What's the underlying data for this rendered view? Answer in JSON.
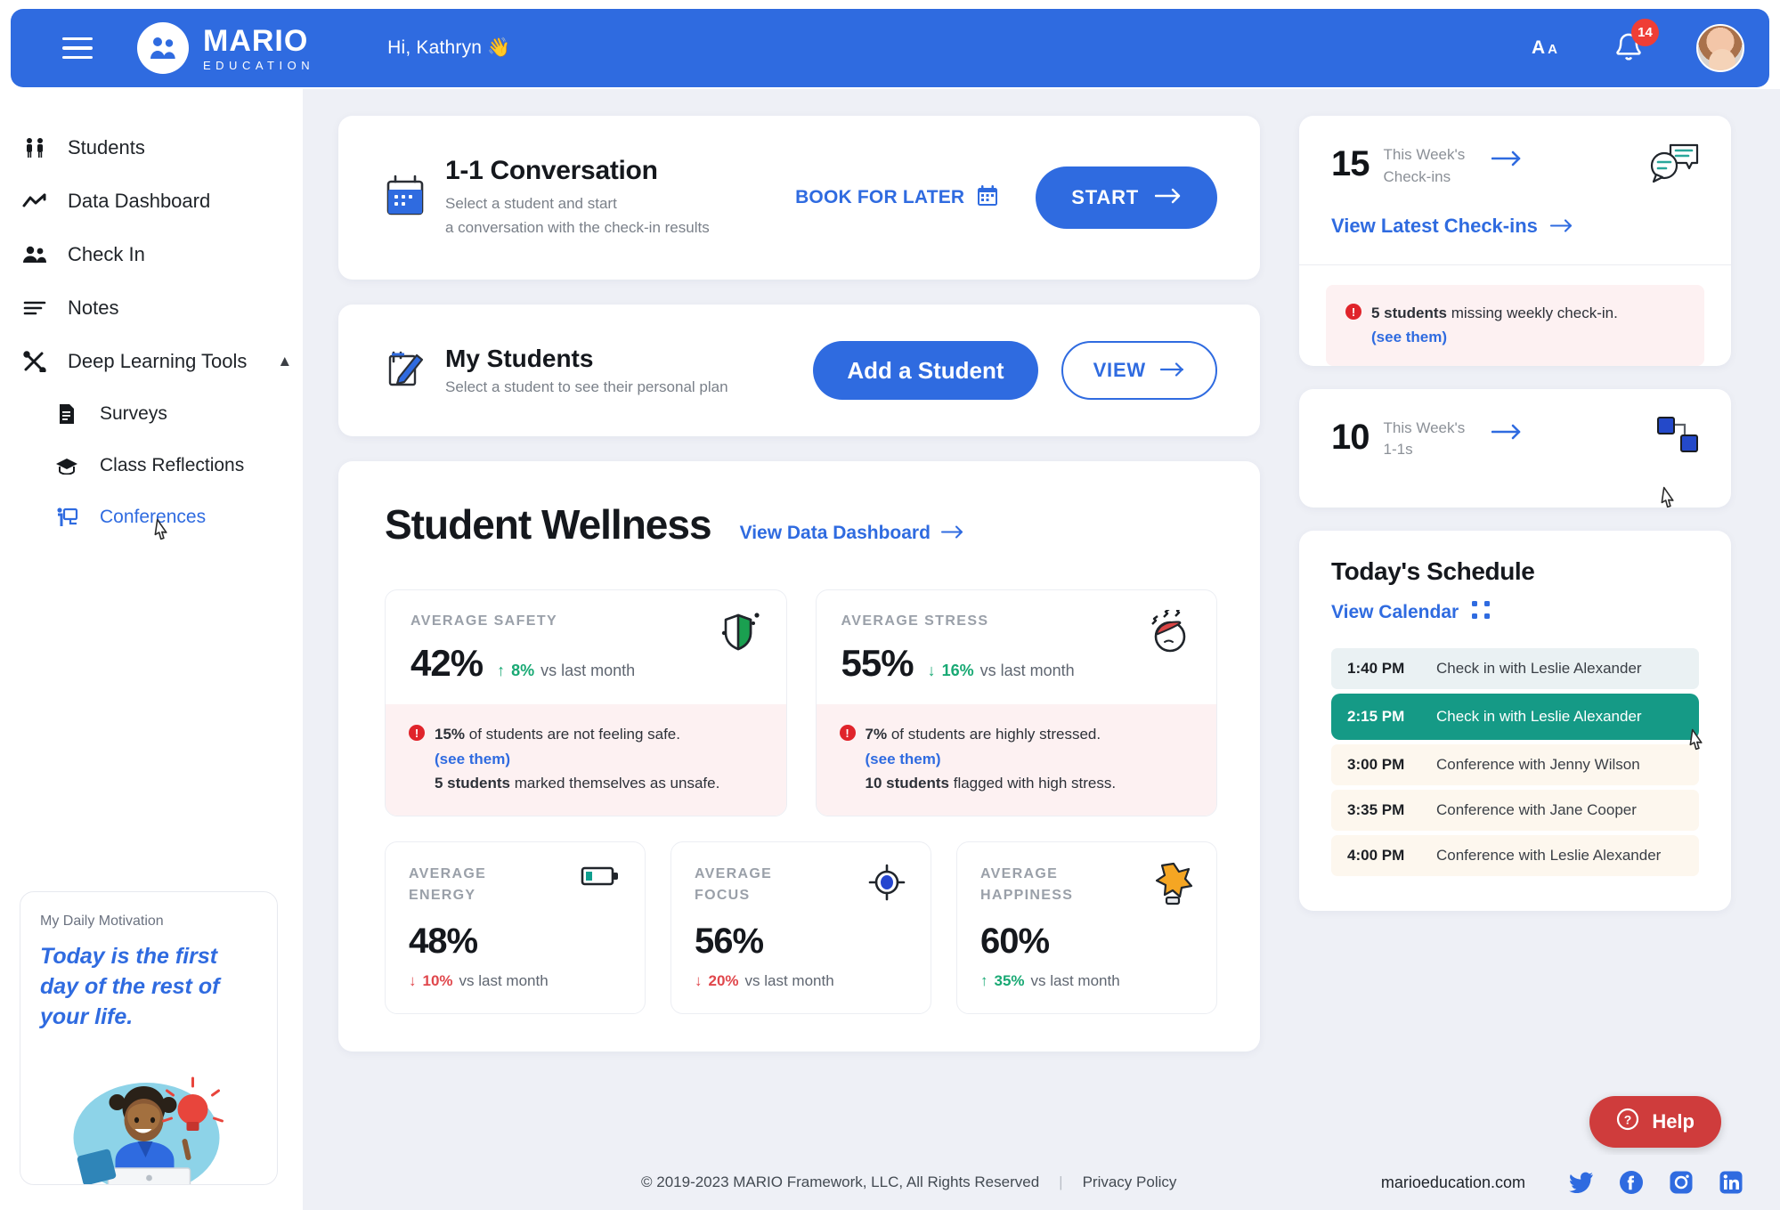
{
  "header": {
    "logo_main": "MARIO",
    "logo_sub": "EDUCATION",
    "greeting": "Hi, Kathryn 👋",
    "font_size_big": "A",
    "font_size_small": "A",
    "notification_count": "14"
  },
  "sidebar": {
    "items": [
      {
        "label": "Students",
        "icon": "students-icon"
      },
      {
        "label": "Data Dashboard",
        "icon": "chart-line-icon"
      },
      {
        "label": "Check In",
        "icon": "people-icon"
      },
      {
        "label": "Notes",
        "icon": "lines-icon"
      },
      {
        "label": "Deep Learning Tools",
        "icon": "tools-icon",
        "expanded": true
      }
    ],
    "sub_items": [
      {
        "label": "Surveys",
        "icon": "document-icon",
        "active": false
      },
      {
        "label": "Class Reflections",
        "icon": "graduation-cap-icon",
        "active": false
      },
      {
        "label": "Conferences",
        "icon": "presentation-icon",
        "active": true
      }
    ],
    "motivation": {
      "label": "My Daily Motivation",
      "quote": "Today is the first day of the rest of your life."
    }
  },
  "conversation_card": {
    "title": "1-1 Conversation",
    "subtitle_line1": "Select a student and start",
    "subtitle_line2": "a conversation with the check-in results",
    "book_label": "BOOK FOR LATER",
    "start_label": "START"
  },
  "students_card": {
    "title": "My Students",
    "subtitle": "Select a student to see their personal plan",
    "add_label": "Add a Student",
    "view_label": "VIEW"
  },
  "wellness": {
    "title": "Student Wellness",
    "link": "View Data Dashboard",
    "big_metrics": [
      {
        "label": "AVERAGE SAFETY",
        "value": "42%",
        "delta_dir": "up",
        "delta_color": "green",
        "delta_value": "8%",
        "delta_suffix": "vs last month",
        "icon": "shield-icon",
        "alert_pct": "15%",
        "alert_text": "of students are not feeling safe.",
        "alert_link": "(see them)",
        "alert_count": "5 students",
        "alert_count_text": "marked themselves as unsafe."
      },
      {
        "label": "AVERAGE STRESS",
        "value": "55%",
        "delta_dir": "down",
        "delta_color": "green",
        "delta_value": "16%",
        "delta_suffix": "vs last month",
        "icon": "stressed-face-icon",
        "alert_pct": "7%",
        "alert_text": "of students are highly stressed.",
        "alert_link": "(see them)",
        "alert_count": "10 students",
        "alert_count_text": "flagged with high stress."
      }
    ],
    "small_metrics": [
      {
        "label_l1": "AVERAGE",
        "label_l2": "ENERGY",
        "value": "48%",
        "delta_dir": "down",
        "delta_color": "red",
        "delta_value": "10%",
        "delta_suffix": "vs last month",
        "icon": "battery-icon"
      },
      {
        "label_l1": "AVERAGE",
        "label_l2": "FOCUS",
        "value": "56%",
        "delta_dir": "down",
        "delta_color": "red",
        "delta_value": "20%",
        "delta_suffix": "vs last month",
        "icon": "target-icon"
      },
      {
        "label_l1": "AVERAGE",
        "label_l2": "HAPPINESS",
        "value": "60%",
        "delta_dir": "up",
        "delta_color": "green",
        "delta_value": "35%",
        "delta_suffix": "vs last month",
        "icon": "star-trophy-icon"
      }
    ]
  },
  "checkins_card": {
    "number": "15",
    "label_l1": "This Week's",
    "label_l2": "Check-ins",
    "icon": "chat-bubbles-icon",
    "link": "View Latest Check-ins",
    "alert_count": "5 students",
    "alert_text": "missing weekly check-in.",
    "alert_link": "(see them)"
  },
  "ones_card": {
    "number": "10",
    "label_l1": "This Week's",
    "label_l2": "1-1s",
    "icon": "nodes-icon"
  },
  "schedule": {
    "title": "Today's Schedule",
    "link": "View Calendar",
    "items": [
      {
        "time": "1:40 PM",
        "desc": "Check in with Leslie Alexander",
        "style": "blue"
      },
      {
        "time": "2:15 PM",
        "desc": "Check in with Leslie Alexander",
        "style": "green"
      },
      {
        "time": "3:00 PM",
        "desc": "Conference with Jenny Wilson",
        "style": "cream"
      },
      {
        "time": "3:35 PM",
        "desc": "Conference with Jane Cooper",
        "style": "cream"
      },
      {
        "time": "4:00 PM",
        "desc": "Conference with Leslie Alexander",
        "style": "cream"
      }
    ]
  },
  "help_button": {
    "label": "Help"
  },
  "footer": {
    "copyright": "© 2019-2023 MARIO Framework, LLC, All Rights Reserved",
    "separator": "|",
    "privacy": "Privacy Policy",
    "website": "marioeducation.com",
    "socials": [
      "twitter-icon",
      "facebook-icon",
      "instagram-icon",
      "linkedin-icon"
    ]
  },
  "colors": {
    "brand_blue": "#2f6be0",
    "accent_green": "#159a86",
    "alert_red": "#e0242b",
    "help_red": "#cf3c3c",
    "bg": "#eef0f6"
  }
}
